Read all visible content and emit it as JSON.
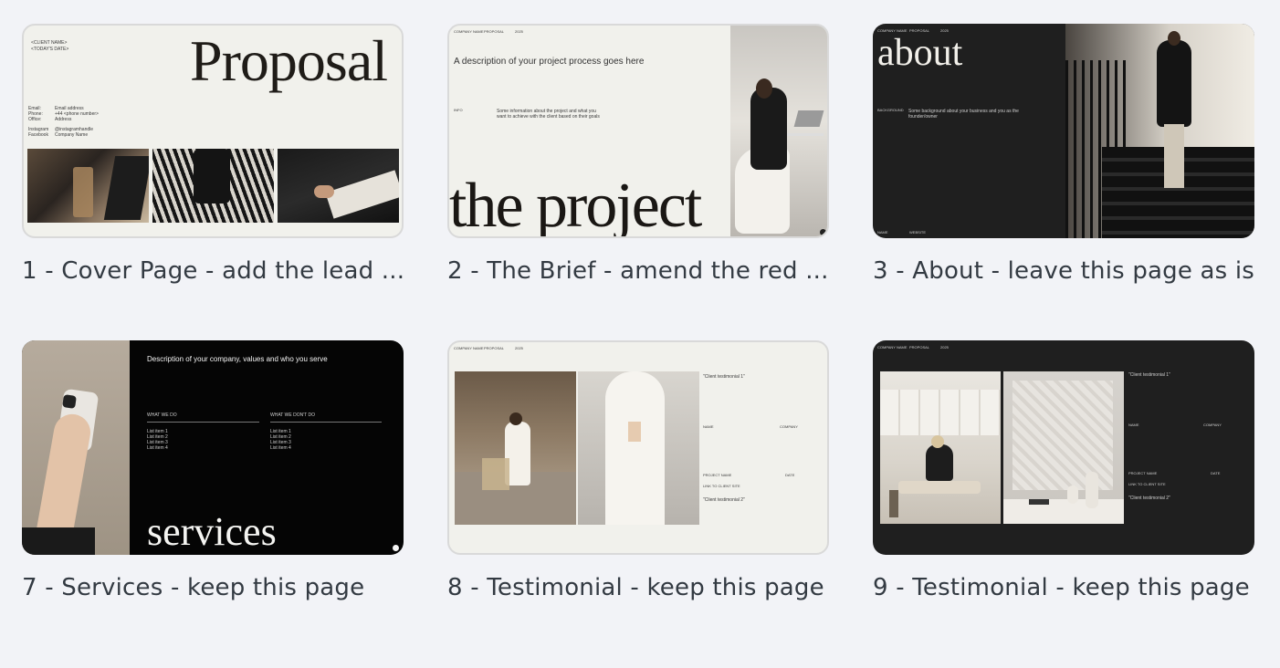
{
  "cards": [
    {
      "caption": "1 - Cover Page - add the lead ...",
      "title": "Proposal",
      "client_name": "<CLIENT NAME>",
      "todays_date": "<TODAY'S DATE>",
      "contact_labels": [
        "Email:",
        "Phone:",
        "Office:"
      ],
      "contact_values": [
        "Email address",
        "+44 <phone number>",
        "Address"
      ],
      "social_labels": [
        "Instagram",
        "Facebook"
      ],
      "social_values": [
        "@instagramhandle",
        "Company Name"
      ]
    },
    {
      "caption": "2 - The Brief - amend the red ...",
      "title": "the project",
      "header": [
        "COMPANY NAME",
        "PROPOSAL",
        "2025"
      ],
      "description": "A description of your project process goes here",
      "info_label": "INFO",
      "info_text_1": "Some information about the project and what you",
      "info_text_2": "want to achieve with the client based on their goals"
    },
    {
      "caption": "3 - About - leave this page as is",
      "title": "about",
      "header": [
        "COMPANY NAME",
        "PROPOSAL",
        "2025"
      ],
      "background_label": "BACKGROUND",
      "background_text_1": "Some background about your business and you as the",
      "background_text_2": "founder/owner",
      "footer": [
        "NAME",
        "WEBSITE"
      ]
    },
    {
      "caption": "7 - Services - keep this page",
      "title": "services",
      "description": "Description of your company, values and who you serve",
      "col1_title": "WHAT WE DO",
      "col2_title": "WHAT WE DON'T DO",
      "col1_items": [
        "List item 1",
        "List item 2",
        "List item 3",
        "List item 4"
      ],
      "col2_items": [
        "List item 1",
        "List item 2",
        "List item 3",
        "List item 4"
      ]
    },
    {
      "caption": "8 - Testimonial - keep this page",
      "header": [
        "COMPANY NAME",
        "PROPOSAL",
        "2025"
      ],
      "testimonial_1": "\"Client testimonial 1\"",
      "name_label": "NAME",
      "company_label": "COMPANY",
      "project_label": "PROJECT NAME",
      "date_label": "DATE",
      "link_label": "LINK TO CLIENT SITE",
      "testimonial_2": "\"Client testimonial 2\""
    },
    {
      "caption": "9 - Testimonial - keep this page",
      "header": [
        "COMPANY NAME",
        "PROPOSAL",
        "2025"
      ],
      "testimonial_1": "\"Client testimonial 1\"",
      "name_label": "NAME",
      "company_label": "COMPANY",
      "project_label": "PROJECT NAME",
      "date_label": "DATE",
      "link_label": "LINK TO CLIENT SITE",
      "testimonial_2": "\"Client testimonial 2\""
    }
  ]
}
